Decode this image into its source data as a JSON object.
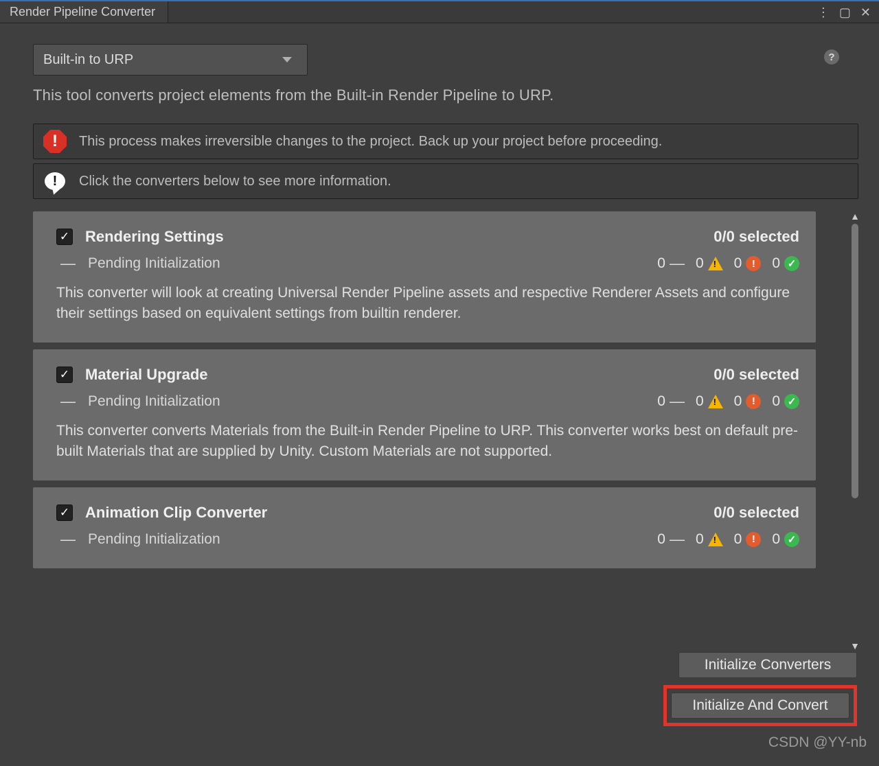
{
  "window": {
    "title": "Render Pipeline Converter"
  },
  "dropdown": {
    "selected": "Built-in to URP"
  },
  "description": "This tool converts project elements from the Built-in Render Pipeline to URP.",
  "banners": {
    "warning": "This process makes irreversible changes to the project. Back up your project before proceeding.",
    "info": "Click the converters below to see more information."
  },
  "converters": [
    {
      "checked": true,
      "title": "Rendering Settings",
      "selected_text": "0/0 selected",
      "pending": "Pending Initialization",
      "counts": {
        "dash": "0",
        "warn": "0",
        "err": "0",
        "ok": "0"
      },
      "desc": "This converter will look at creating Universal Render Pipeline assets and respective Renderer Assets and configure their settings based on equivalent settings from builtin renderer."
    },
    {
      "checked": true,
      "title": "Material Upgrade",
      "selected_text": "0/0 selected",
      "pending": "Pending Initialization",
      "counts": {
        "dash": "0",
        "warn": "0",
        "err": "0",
        "ok": "0"
      },
      "desc": "This converter converts Materials from the Built-in Render Pipeline to URP. This converter works best on default pre-built Materials that are supplied by Unity. Custom Materials are not supported."
    },
    {
      "checked": true,
      "title": "Animation Clip Converter",
      "selected_text": "0/0 selected",
      "pending": "Pending Initialization",
      "counts": {
        "dash": "0",
        "warn": "0",
        "err": "0",
        "ok": "0"
      },
      "desc": ""
    }
  ],
  "buttons": {
    "initialize": "Initialize Converters",
    "initialize_convert": "Initialize And Convert"
  },
  "watermark": "CSDN @YY-nb"
}
